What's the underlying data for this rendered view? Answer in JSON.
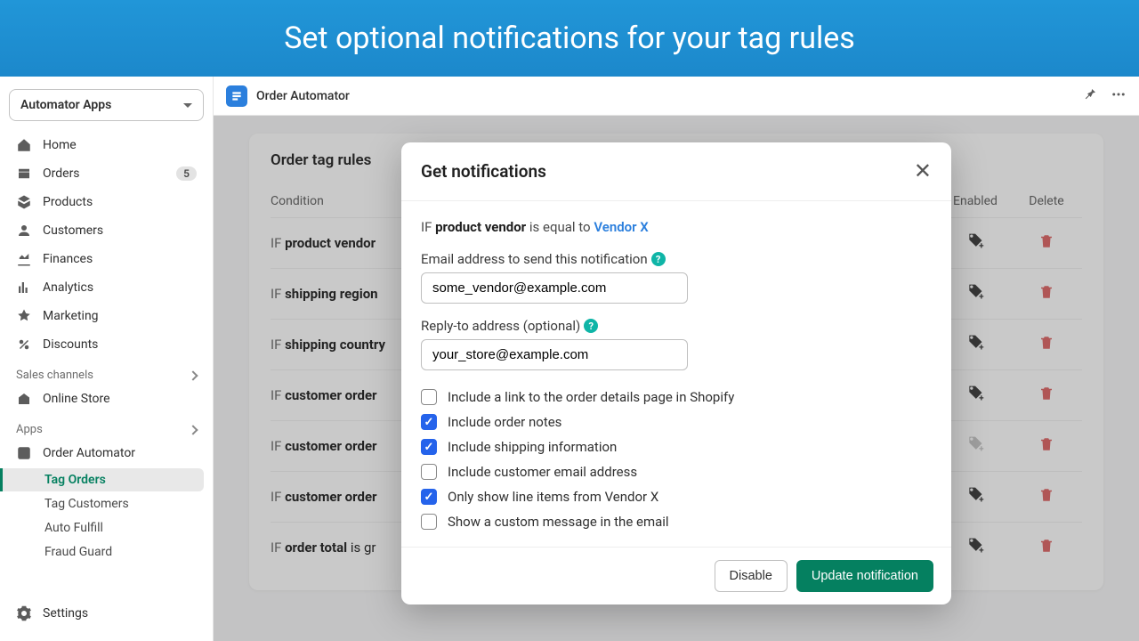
{
  "banner": "Set optional notifications for your tag rules",
  "sidebar": {
    "app_select": "Automator Apps",
    "nav": [
      {
        "label": "Home",
        "icon": "home"
      },
      {
        "label": "Orders",
        "icon": "orders",
        "badge": "5"
      },
      {
        "label": "Products",
        "icon": "products"
      },
      {
        "label": "Customers",
        "icon": "customers"
      },
      {
        "label": "Finances",
        "icon": "finances"
      },
      {
        "label": "Analytics",
        "icon": "analytics"
      },
      {
        "label": "Marketing",
        "icon": "marketing"
      },
      {
        "label": "Discounts",
        "icon": "discounts"
      }
    ],
    "sales_channels": "Sales channels",
    "online_store": "Online Store",
    "apps_label": "Apps",
    "app_item": "Order Automator",
    "sub": [
      "Tag Orders",
      "Tag Customers",
      "Auto Fulfill",
      "Fraud Guard"
    ],
    "settings": "Settings"
  },
  "topbar": {
    "title": "Order Automator"
  },
  "card": {
    "title": "Order tag rules",
    "th_cond": "Condition",
    "th_enabled": "Enabled",
    "th_delete": "Delete",
    "rows": [
      {
        "field": "product vendor"
      },
      {
        "field": "shipping region"
      },
      {
        "field": "shipping country"
      },
      {
        "field": "customer order"
      },
      {
        "field": "customer order",
        "dim": true
      },
      {
        "field": "customer order"
      },
      {
        "field": "order total",
        "suffix": " is gr"
      }
    ]
  },
  "modal": {
    "title": "Get notifications",
    "cond_if": "IF",
    "cond_field": "product vendor",
    "cond_op": "is equal to",
    "cond_val": "Vendor X",
    "email_label": "Email address to send this notification",
    "email_value": "some_vendor@example.com",
    "reply_label": "Reply-to address (optional)",
    "reply_value": "your_store@example.com",
    "checks": [
      {
        "label": "Include a link to the order details page in Shopify",
        "checked": false
      },
      {
        "label": "Include order notes",
        "checked": true
      },
      {
        "label": "Include shipping information",
        "checked": true
      },
      {
        "label": "Include customer email address",
        "checked": false
      },
      {
        "label": "Only show line items from Vendor X",
        "checked": true
      },
      {
        "label": "Show a custom message in the email",
        "checked": false
      }
    ],
    "disable": "Disable",
    "update": "Update notification"
  }
}
